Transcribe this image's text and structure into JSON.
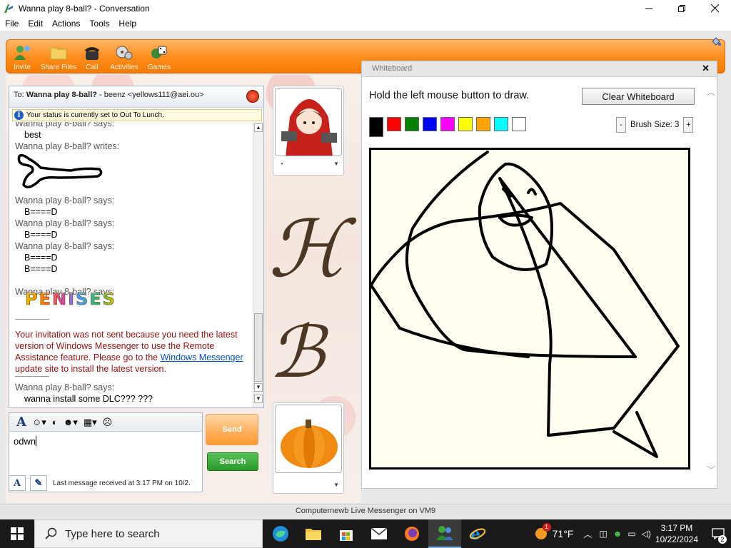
{
  "window": {
    "title": "Wanna play 8-ball? - Conversation"
  },
  "menu": [
    "File",
    "Edit",
    "Actions",
    "Tools",
    "Help"
  ],
  "toolbar": [
    "Invite",
    "Share Files",
    "Call",
    "Activities",
    "Games"
  ],
  "conversation": {
    "to_label": "To:",
    "to_name": "Wanna play 8-ball?",
    "to_rest": " - beenz <yellows111@aei.ou>",
    "status_notice": "Your status is currently set to Out To Lunch.",
    "messages": [
      {
        "sender": "Wanna play 8-ball? says:",
        "lines": [
          "best"
        ]
      },
      {
        "sender": "Wanna play 8-ball? writes:",
        "lines": []
      },
      {
        "sender": "Wanna play 8-ball? says:",
        "lines": [
          "B====D"
        ]
      },
      {
        "sender": "Wanna play 8-ball? says:",
        "lines": [
          "B====D"
        ]
      },
      {
        "sender": "Wanna play 8-ball? says:",
        "lines": [
          "B====D",
          "B====D"
        ]
      },
      {
        "sender": "Wanna play 8-ball? says:",
        "lines": []
      }
    ],
    "big_text": "PENISES",
    "error_text_1": "Your invitation was not sent because you need the latest version of Windows Messenger to use the Remote Assistance feature. Please go to the ",
    "error_link": "Windows Messenger",
    "error_text_2": " update site to install the latest version.",
    "last_sender": "Wanna play 8-ball? says:",
    "last_line": "wanna install some DLC??? ???"
  },
  "input": {
    "value": "odwn"
  },
  "buttons": {
    "send": "Send",
    "search": "Search"
  },
  "status_bottom": "Last message received at 3:17 PM on 10/2.",
  "whiteboard": {
    "title": "Whiteboard",
    "instruction": "Hold the left mouse button to draw.",
    "clear": "Clear Whiteboard",
    "colors": [
      "#000000",
      "#ff0000",
      "#008000",
      "#0000ff",
      "#ff00ff",
      "#ffff00",
      "#ffa500",
      "#00ffff",
      "#ffffff"
    ],
    "brush_minus": "-",
    "brush_plus": "+",
    "brush_label": "Brush Size: 3"
  },
  "frame_status": "Computernewb Live Messenger on VM9",
  "taskbar": {
    "search_placeholder": "Type here to search",
    "weather_badge": "1",
    "temperature": "71°F",
    "time": "3:17 PM",
    "date": "10/22/2024",
    "notification_count": "2"
  }
}
